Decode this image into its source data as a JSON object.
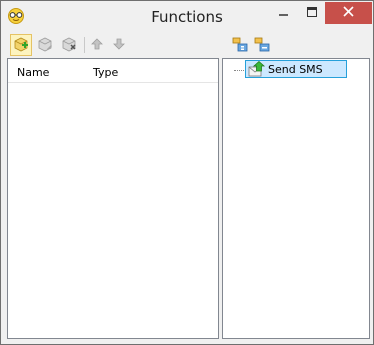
{
  "window": {
    "title": "Functions",
    "icon": "glasses-icon",
    "controls": {
      "minimize_icon": "minimize-icon",
      "maximize_icon": "maximize-icon",
      "close_icon": "close-icon"
    }
  },
  "toolbar_left": [
    {
      "name": "add-function",
      "icon": "add-icon",
      "state": "active"
    },
    {
      "name": "edit-function",
      "icon": "edit-icon",
      "state": "disabled"
    },
    {
      "name": "delete-function",
      "icon": "delete-icon",
      "state": "disabled"
    },
    {
      "name": "move-up",
      "icon": "arrow-up-icon",
      "state": "disabled"
    },
    {
      "name": "move-down",
      "icon": "arrow-down-icon",
      "state": "disabled"
    }
  ],
  "toolbar_right": [
    {
      "name": "expand-all",
      "icon": "expand-all-icon",
      "state": "enabled"
    },
    {
      "name": "collapse-all",
      "icon": "collapse-all-icon",
      "state": "enabled"
    }
  ],
  "list": {
    "columns": [
      "Name",
      "Type"
    ],
    "rows": []
  },
  "tree": {
    "nodes": [
      {
        "label": "Send SMS",
        "icon": "send-sms-icon",
        "selected": true
      }
    ]
  },
  "colors": {
    "window_bg": "#f0f0f0",
    "close_button": "#c7504a",
    "selection_bg": "#cce8ff",
    "selection_border": "#26a0da"
  }
}
